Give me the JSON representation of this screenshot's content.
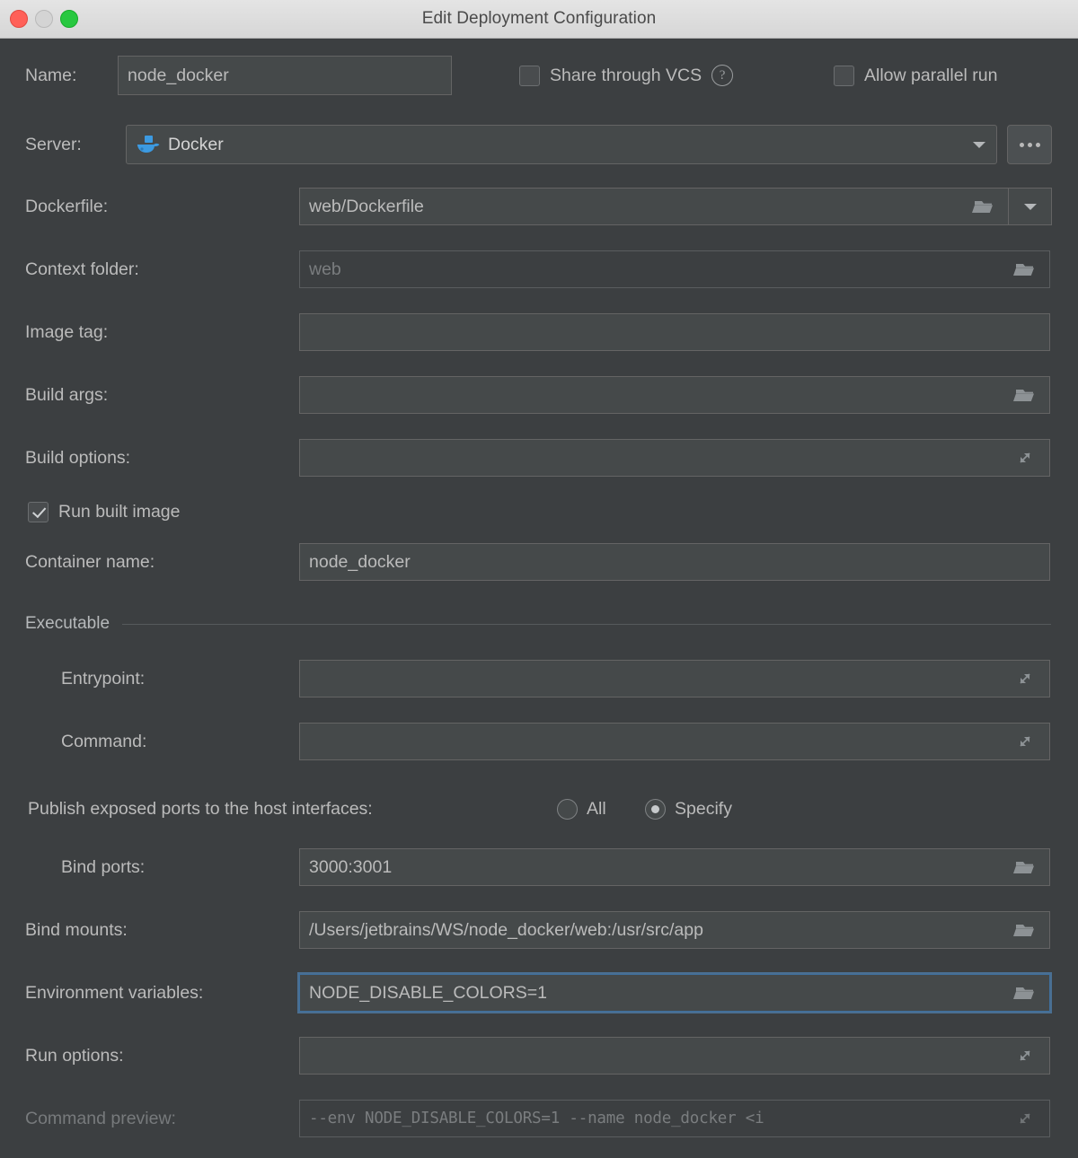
{
  "window": {
    "title": "Edit Deployment Configuration",
    "traffic_lights": [
      "close-red",
      "minimize-gray",
      "zoom-green"
    ]
  },
  "form": {
    "name": {
      "label": "Name:",
      "value": "node_docker"
    },
    "share_through_vcs": {
      "label": "Share through VCS",
      "checked": false,
      "help": "?"
    },
    "allow_parallel_run": {
      "label": "Allow parallel run",
      "checked": false
    },
    "server": {
      "label": "Server:",
      "value": "Docker",
      "icon": "docker-whale-icon",
      "more_button": "..."
    },
    "dockerfile": {
      "label": "Dockerfile:",
      "value": "web/Dockerfile"
    },
    "context_folder": {
      "label": "Context folder:",
      "value": "web",
      "enabled": false
    },
    "image_tag": {
      "label": "Image tag:",
      "value": ""
    },
    "build_args": {
      "label": "Build args:",
      "value": ""
    },
    "build_options": {
      "label": "Build options:",
      "value": ""
    },
    "run_built_image": {
      "label": "Run built image",
      "checked": true
    },
    "container_name": {
      "label": "Container name:",
      "value": "node_docker"
    },
    "executable_section": {
      "label": "Executable"
    },
    "entrypoint": {
      "label": "Entrypoint:",
      "value": ""
    },
    "command": {
      "label": "Command:",
      "value": ""
    },
    "publish_ports": {
      "label": "Publish exposed ports to the host interfaces:",
      "options": [
        "All",
        "Specify"
      ],
      "selected": "Specify"
    },
    "bind_ports": {
      "label": "Bind ports:",
      "value": "3000:3001"
    },
    "bind_mounts": {
      "label": "Bind mounts:",
      "value": "/Users/jetbrains/WS/node_docker/web:/usr/src/app"
    },
    "environment_variables": {
      "label": "Environment variables:",
      "value": "NODE_DISABLE_COLORS=1",
      "focused": true
    },
    "run_options": {
      "label": "Run options:",
      "value": ""
    },
    "command_preview": {
      "label": "Command preview:",
      "value": "--env NODE_DISABLE_COLORS=1 --name node_docker <i",
      "enabled": false
    }
  },
  "colors": {
    "background": "#3c3f41",
    "field_background": "#45494a",
    "border": "#646464",
    "text": "#bbbbbb",
    "dim_text": "#7a7d7f",
    "focus_blue": "#3f709e",
    "docker_blue": "#3c9ae1",
    "titlebar": "#dedede"
  }
}
